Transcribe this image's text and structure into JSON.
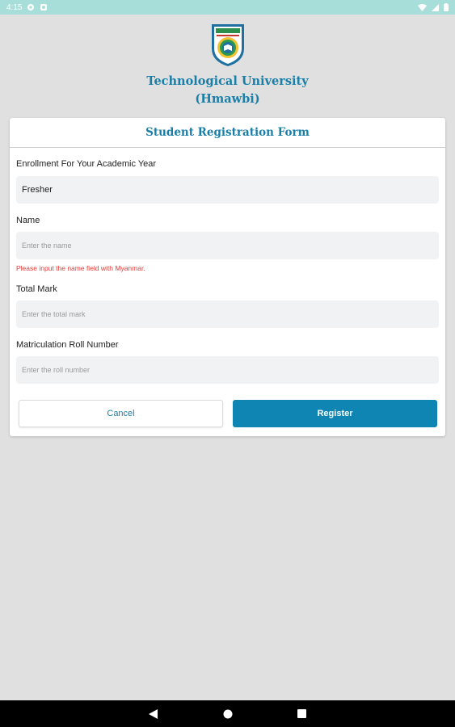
{
  "status_bar": {
    "time": "4:15"
  },
  "header": {
    "logo_icon": "university-crest-icon",
    "university_line1": "Technological University",
    "university_line2": "(Hmawbi)"
  },
  "form": {
    "title": "Student Registration Form",
    "fields": [
      {
        "label": "Enrollment For Your Academic Year",
        "value": "Fresher",
        "placeholder": ""
      },
      {
        "label": "Name",
        "value": "",
        "placeholder": "Enter the name",
        "error": "Please input the name field with Myanmar."
      },
      {
        "label": "Total Mark",
        "value": "",
        "placeholder": "Enter the total mark"
      },
      {
        "label": "Matriculation Roll Number",
        "value": "",
        "placeholder": "Enter the roll number"
      }
    ],
    "cancel_label": "Cancel",
    "register_label": "Register"
  },
  "nav_bar": {
    "icons": [
      "back-icon",
      "home-icon",
      "recents-icon"
    ]
  },
  "colors": {
    "accent": "#1a7fa8",
    "button": "#0f85b4",
    "error": "#e53935",
    "status_bar": "#a8ded9"
  }
}
